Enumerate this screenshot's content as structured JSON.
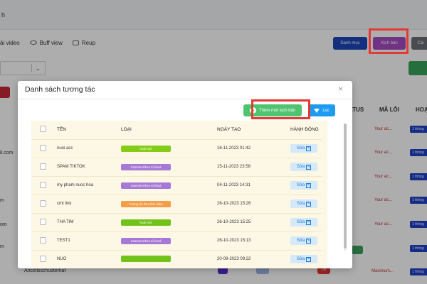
{
  "app": {
    "title_fragment": "h",
    "toolbar": [
      {
        "label": "ải video",
        "icon": "video-icon"
      },
      {
        "label": "Buff view",
        "icon": "eye-icon"
      },
      {
        "label": "Reup",
        "icon": "doc-icon"
      }
    ],
    "top_buttons": {
      "danh_muc": "Danh mục",
      "kich_ban": "Kịch bản",
      "cai": "Cài"
    },
    "colors": {
      "danh_muc": "#1e46b8",
      "kich_ban": "#a54bc2",
      "overlay": "#000000"
    },
    "columns_right": [
      "ATUS",
      "MÃ LỖI",
      "HOẠT"
    ],
    "left_texts": [
      "il.com",
      "m",
      "om",
      "m"
    ],
    "right_red_texts": [
      "Your ac...",
      "Your ac...",
      "Your ac...",
      "Your ac...",
      "Your ac..."
    ],
    "right_badge": "1 thông",
    "bottom_row": {
      "name": "Aricelisschusterkaf",
      "maximum": "Maximum...",
      "badge": "Lỗi"
    }
  },
  "modal": {
    "title": "Danh sách tương tác",
    "close_icon": "×",
    "add_button": "Thêm mới kịch bản",
    "filter_button": "Lọc",
    "columns": [
      "TÊN",
      "LOẠI",
      "NGÀY TẠO",
      "HÀNH ĐỘNG"
    ],
    "edit_label": "Sửa",
    "rows": [
      {
        "name": "nuoi acc",
        "type": "Nuôi nick",
        "type_color": "green",
        "date": "16-11-2023 01:42"
      },
      {
        "name": "SPAM TIKTOK",
        "type": "Comment theo từ khoá",
        "type_color": "purple",
        "date": "15-11-2023 23:58"
      },
      {
        "name": "my pham nuoc hoa",
        "type": "Comment theo từ khoá",
        "type_color": "purple",
        "date": "04-11-2023 14:31"
      },
      {
        "name": "cmt link",
        "type": "Tương tác theo link video",
        "type_color": "orange",
        "date": "26-10-2023 15:26"
      },
      {
        "name": "THA TIM",
        "type": "Nuôi nick",
        "type_color": "lime",
        "date": "26-10-2023 15:25"
      },
      {
        "name": "TEST1",
        "type": "Comment theo từ khoá",
        "type_color": "purple",
        "date": "26-10-2023 15:13"
      },
      {
        "name": "NUO",
        "type": "",
        "type_color": "lime",
        "date": "20-09-2023 09:22"
      }
    ]
  }
}
